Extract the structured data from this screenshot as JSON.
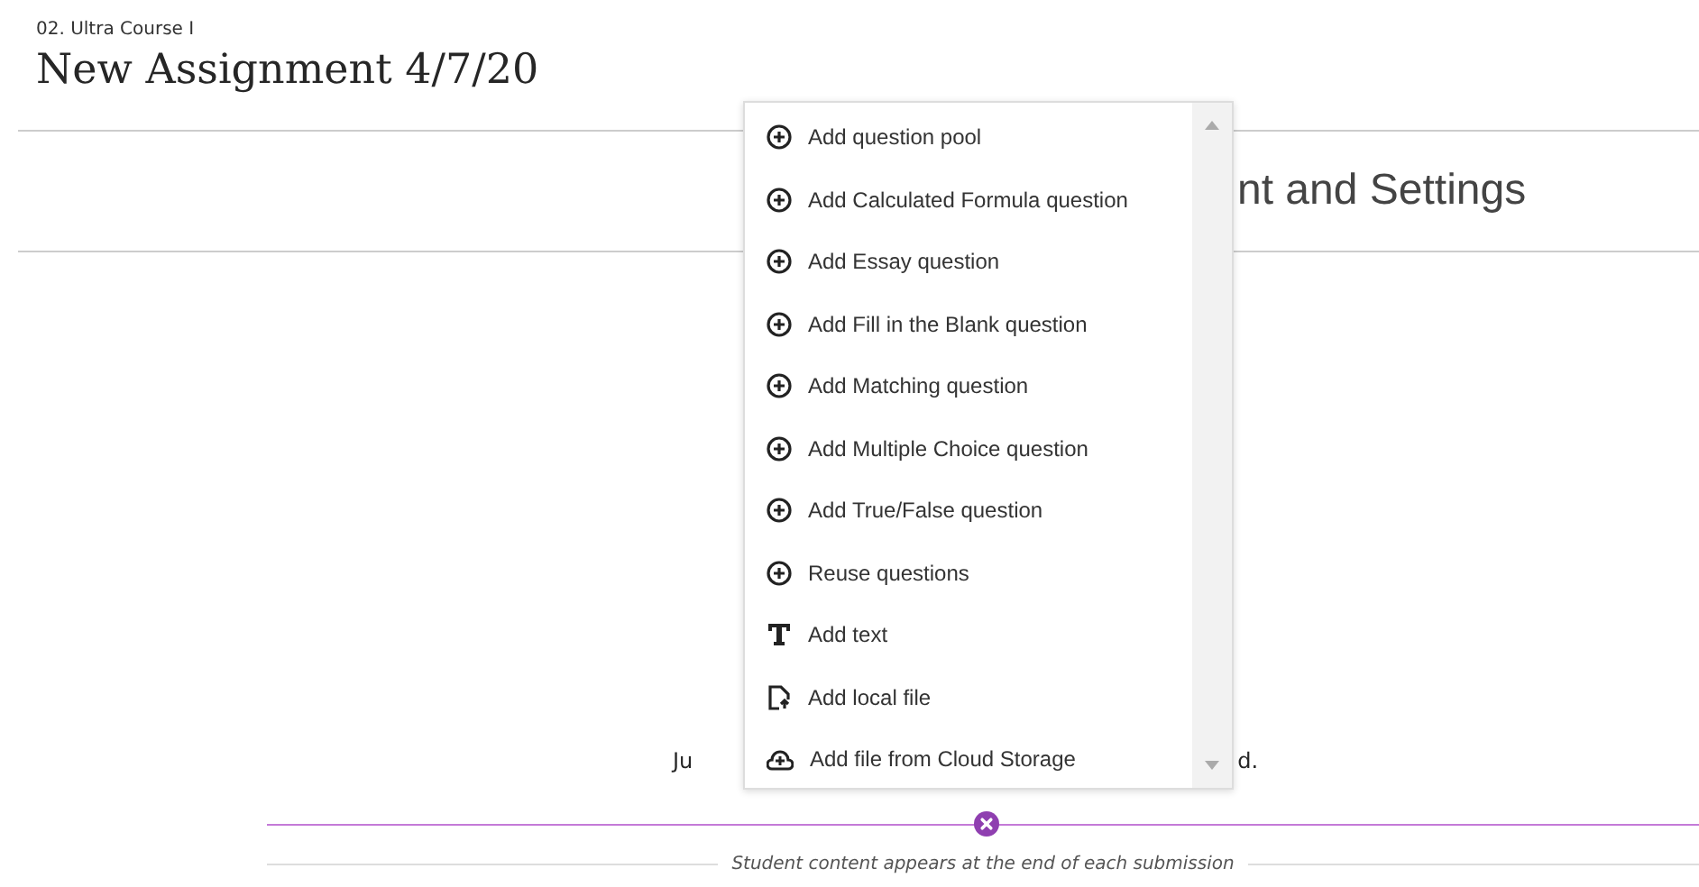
{
  "breadcrumb": "02. Ultra Course I",
  "title": "New Assignment 4/7/20",
  "section_heading": "nt and Settings",
  "hidden_text_left": "Ju",
  "hidden_text_right": "d.",
  "menu": {
    "items": [
      {
        "kind": "plus",
        "label": "Add question pool"
      },
      {
        "kind": "plus",
        "label": "Add Calculated Formula question"
      },
      {
        "kind": "plus",
        "label": "Add Essay question"
      },
      {
        "kind": "plus",
        "label": "Add Fill in the Blank question"
      },
      {
        "kind": "plus",
        "label": "Add Matching question"
      },
      {
        "kind": "plus",
        "label": "Add Multiple Choice question"
      },
      {
        "kind": "plus",
        "label": "Add True/False question"
      },
      {
        "kind": "plus",
        "label": "Reuse questions"
      },
      {
        "kind": "text",
        "label": "Add text"
      },
      {
        "kind": "file",
        "label": "Add local file"
      },
      {
        "kind": "cloud",
        "label": "Add file from Cloud Storage"
      }
    ]
  },
  "divider_note": "Student content appears at the end of each submission"
}
